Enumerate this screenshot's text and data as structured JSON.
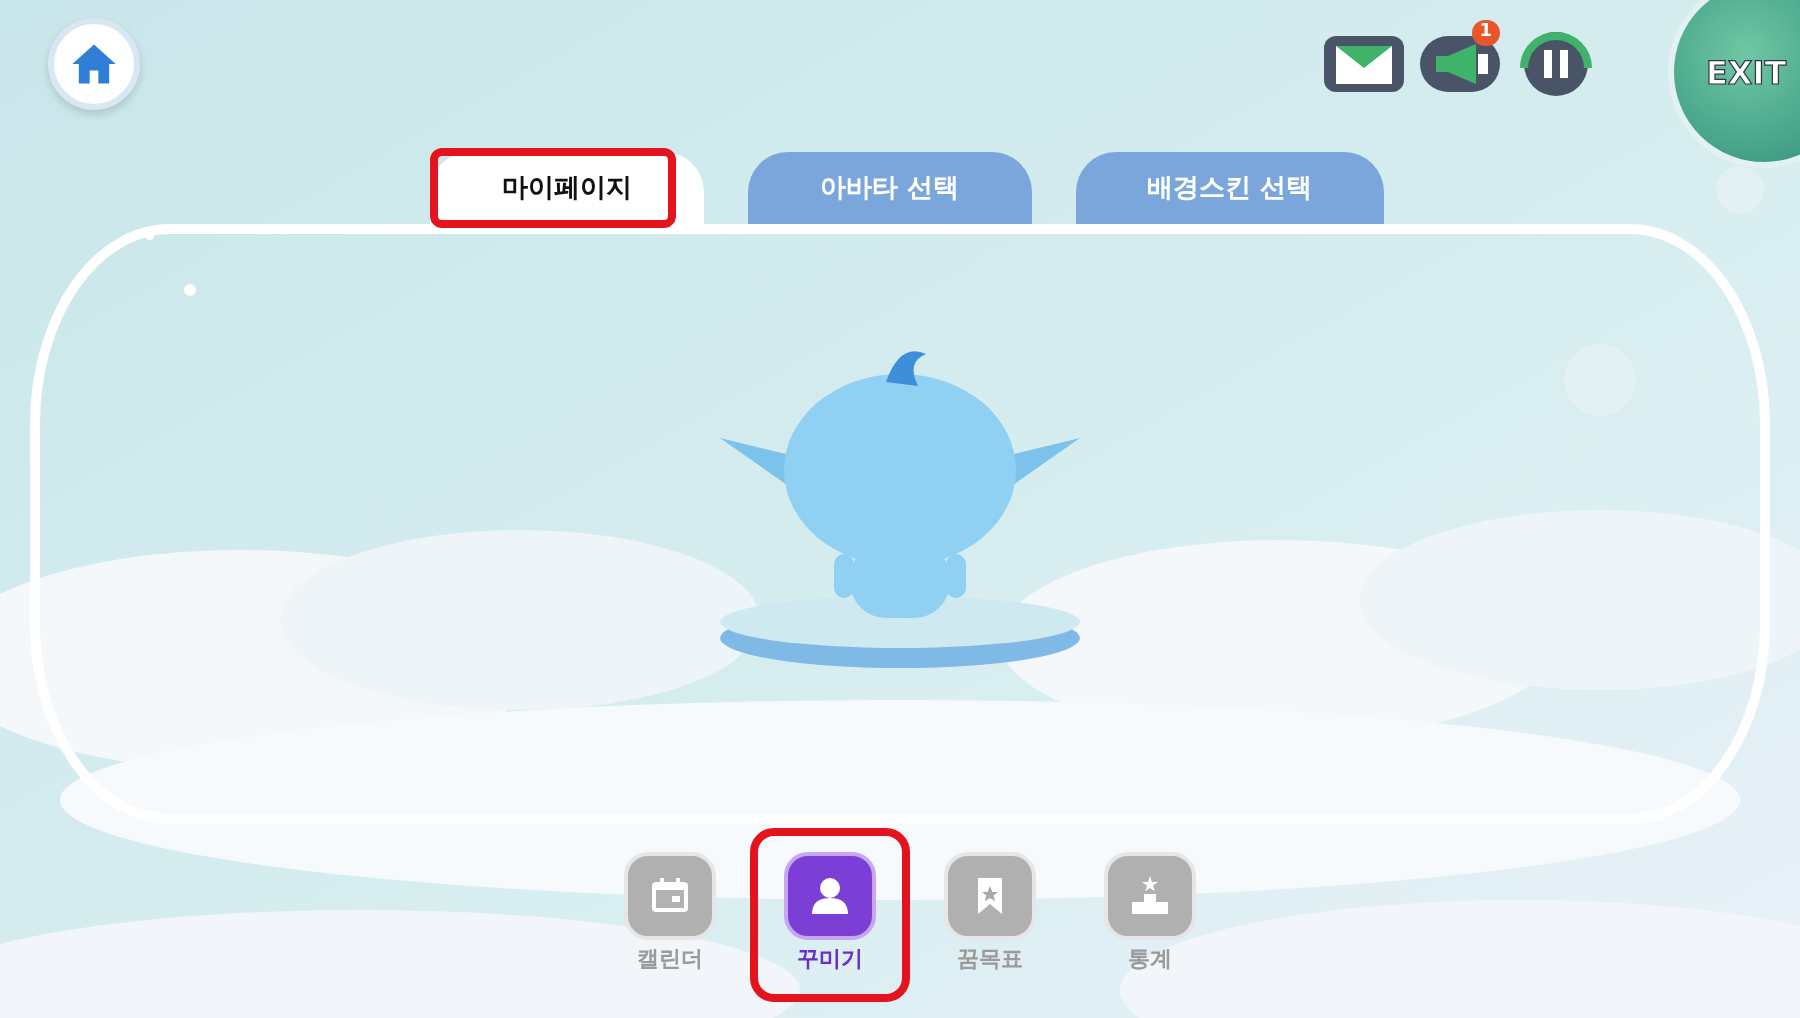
{
  "top_bar": {
    "notification_badge": "1",
    "exit_label": "EXIT"
  },
  "tabs": [
    {
      "label": "마이페이지",
      "selected": true,
      "highlighted": true
    },
    {
      "label": "아바타 선택",
      "selected": false,
      "highlighted": false
    },
    {
      "label": "배경스킨 선택",
      "selected": false,
      "highlighted": false
    }
  ],
  "bottom_nav": [
    {
      "kind": "calendar",
      "label": "캘린더",
      "selected": false,
      "highlighted": false
    },
    {
      "kind": "person",
      "label": "꾸미기",
      "selected": true,
      "highlighted": true
    },
    {
      "kind": "bookmark",
      "label": "꿈목표",
      "selected": false,
      "highlighted": false
    },
    {
      "kind": "podium",
      "label": "통계",
      "selected": false,
      "highlighted": false
    }
  ]
}
